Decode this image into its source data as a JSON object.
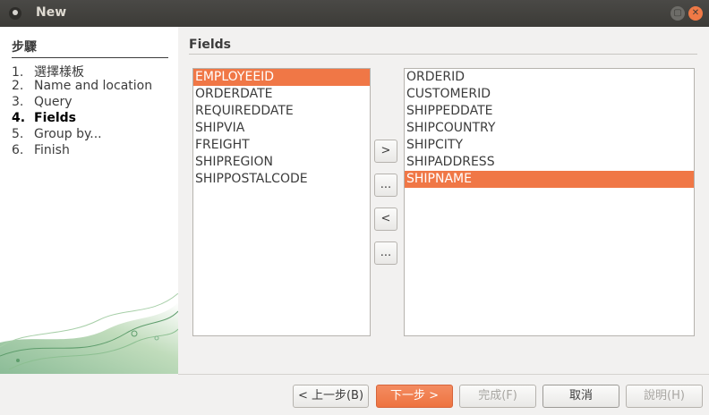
{
  "window": {
    "title": "New"
  },
  "sidebar": {
    "title": "步驟",
    "steps": [
      {
        "num": "1.",
        "label": "選擇樣板"
      },
      {
        "num": "2.",
        "label": "Name and location"
      },
      {
        "num": "3.",
        "label": "Query"
      },
      {
        "num": "4.",
        "label": "Fields"
      },
      {
        "num": "5.",
        "label": "Group by..."
      },
      {
        "num": "6.",
        "label": "Finish"
      }
    ],
    "active_step": 4
  },
  "content": {
    "title": "Fields",
    "available_fields": [
      "EMPLOYEEID",
      "ORDERDATE",
      "REQUIREDDATE",
      "SHIPVIA",
      "FREIGHT",
      "SHIPREGION",
      "SHIPPOSTALCODE"
    ],
    "available_selected": "EMPLOYEEID",
    "selected_fields": [
      "ORDERID",
      "CUSTOMERID",
      "SHIPPEDDATE",
      "SHIPCOUNTRY",
      "SHIPCITY",
      "SHIPADDRESS",
      "SHIPNAME"
    ],
    "selected_selected": "SHIPNAME",
    "transfer_buttons": {
      "add": ">",
      "add_all": "...",
      "remove": "<",
      "remove_all": "..."
    }
  },
  "footer": {
    "back": "< 上一步(B)",
    "next": "下一步 >",
    "finish": "完成(F)",
    "cancel": "取消",
    "help": "說明(H)"
  },
  "colors": {
    "accent": "#f07746",
    "titlebar": "#3c3b37",
    "close_button": "#ef7946"
  }
}
